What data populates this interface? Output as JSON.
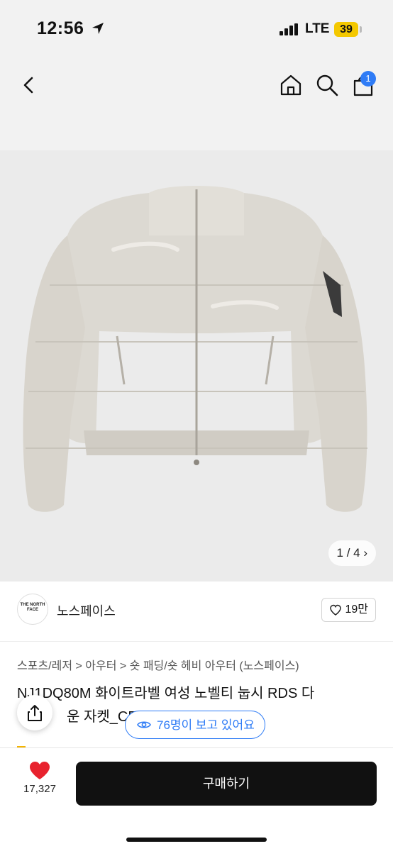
{
  "status_bar": {
    "time": "12:56",
    "network": "LTE",
    "battery": "39"
  },
  "nav": {
    "cart_count": "1",
    "icons": [
      "back-icon",
      "home-icon",
      "search-icon",
      "cart-icon"
    ]
  },
  "product_image": {
    "pager": "1 / 4"
  },
  "seller": {
    "logo_text": "THE NORTH FACE",
    "name": "노스페이스",
    "likes": "19만"
  },
  "breadcrumb": "스포츠/레저 > 아우터 > 숏 패딩/숏 헤비 아우터 (노스페이스)",
  "product": {
    "title_line1": "NJ1DQ80M 화이트라벨 여성 노벨티 눕시 RDS 다",
    "title_line2": "운 자켓_CREAM"
  },
  "viewers": "76명이 보고 있어요",
  "bottom_bar": {
    "wish_count": "17,327",
    "buy_label": "구매하기"
  },
  "colors": {
    "accent": "#2f7cf6",
    "heart": "#e8222e",
    "buy_bg": "#111111",
    "battery": "#f4c800"
  }
}
